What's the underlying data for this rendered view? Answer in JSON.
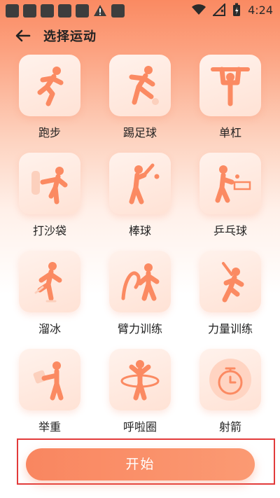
{
  "status_bar": {
    "time": "4:24"
  },
  "header": {
    "title": "选择运动"
  },
  "sports": [
    {
      "label": "跑步",
      "icon": "running-icon"
    },
    {
      "label": "踢足球",
      "icon": "soccer-icon"
    },
    {
      "label": "单杠",
      "icon": "pullup-bar-icon"
    },
    {
      "label": "打沙袋",
      "icon": "punching-bag-icon"
    },
    {
      "label": "棒球",
      "icon": "baseball-icon"
    },
    {
      "label": "乒乓球",
      "icon": "table-tennis-icon"
    },
    {
      "label": "溜冰",
      "icon": "skating-icon"
    },
    {
      "label": "臂力训练",
      "icon": "arm-training-icon"
    },
    {
      "label": "力量训练",
      "icon": "strength-training-icon"
    },
    {
      "label": "举重",
      "icon": "weightlifting-icon"
    },
    {
      "label": "呼啦圈",
      "icon": "hula-hoop-icon"
    },
    {
      "label": "射箭",
      "icon": "stopwatch-icon"
    }
  ],
  "start_button": {
    "label": "开始"
  },
  "colors": {
    "accent": "#f98660",
    "tile": "#ffe6da",
    "highlight_box": "#e23b3b"
  }
}
